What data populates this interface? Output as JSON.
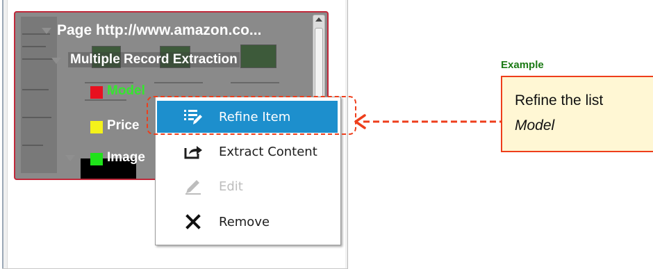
{
  "tree": {
    "page_node": "Page  http://www.amazon.co...",
    "multi_node": "Multiple Record Extraction",
    "fields": [
      {
        "label": "Model",
        "swatch_color": "#e8101f"
      },
      {
        "label": "Price",
        "swatch_color": "#f4f21a"
      },
      {
        "label": "Image",
        "swatch_color": "#1fe31a"
      }
    ]
  },
  "context_menu": {
    "items": [
      {
        "label": "Refine Item",
        "icon": "refine-list-icon",
        "highlighted": true
      },
      {
        "label": "Extract Content",
        "icon": "share-arrow-icon"
      },
      {
        "label": "Edit",
        "icon": "pencil-icon",
        "disabled": true
      },
      {
        "label": "Remove",
        "icon": "close-x-icon"
      }
    ]
  },
  "annotation": {
    "example_label": "Example",
    "line1": "Refine the list",
    "line2": "Model",
    "accent_color": "#ee3e1b",
    "example_color": "#1a7a14",
    "callout_bg": "#fff7d4"
  }
}
